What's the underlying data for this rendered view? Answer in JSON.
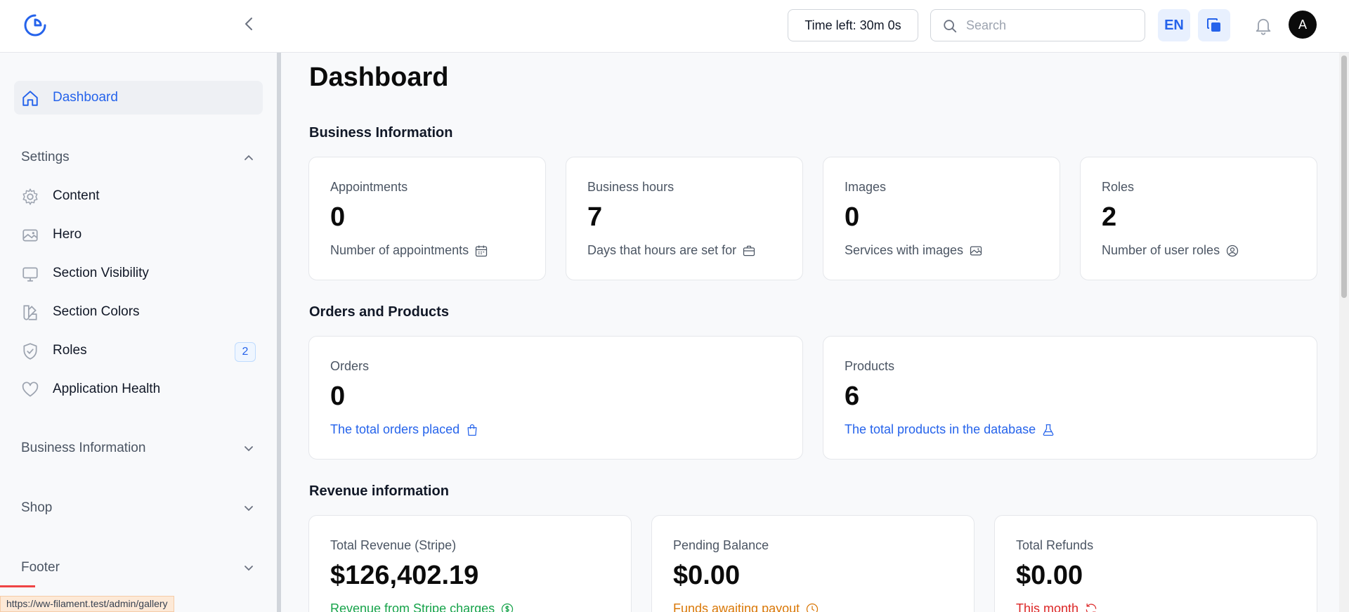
{
  "topbar": {
    "timer": "Time left: 30m 0s",
    "search_placeholder": "Search",
    "language": "EN",
    "avatar_initial": "A"
  },
  "sidebar": {
    "dashboard": "Dashboard",
    "groups": {
      "settings": "Settings",
      "business": "Business Information",
      "shop": "Shop",
      "footer": "Footer"
    },
    "settings_items": [
      {
        "label": "Content",
        "icon": "gear-icon"
      },
      {
        "label": "Hero",
        "icon": "image-icon"
      },
      {
        "label": "Section Visibility",
        "icon": "monitor-icon"
      },
      {
        "label": "Section Colors",
        "icon": "swatch-icon"
      },
      {
        "label": "Roles",
        "icon": "shield-check-icon",
        "badge": "2"
      },
      {
        "label": "Application Health",
        "icon": "heart-icon"
      }
    ]
  },
  "main": {
    "title": "Dashboard",
    "sections": {
      "business": "Business Information",
      "orders": "Orders and Products",
      "revenue": "Revenue information"
    },
    "business_cards": [
      {
        "label": "Appointments",
        "value": "0",
        "desc": "Number of appointments",
        "icon": "calendar-icon"
      },
      {
        "label": "Business hours",
        "value": "7",
        "desc": "Days that hours are set for",
        "icon": "briefcase-icon"
      },
      {
        "label": "Images",
        "value": "0",
        "desc": "Services with images",
        "icon": "photo-icon"
      },
      {
        "label": "Roles",
        "value": "2",
        "desc": "Number of user roles",
        "icon": "user-circle-icon"
      }
    ],
    "order_cards": [
      {
        "label": "Orders",
        "value": "0",
        "desc": "The total orders placed",
        "icon": "shopping-bag-icon"
      },
      {
        "label": "Products",
        "value": "6",
        "desc": "The total products in the database",
        "icon": "beaker-icon"
      }
    ],
    "revenue_cards": [
      {
        "label": "Total Revenue (Stripe)",
        "value": "$126,402.19",
        "desc": "Revenue from Stripe charges",
        "icon": "currency-dollar-icon"
      },
      {
        "label": "Pending Balance",
        "value": "$0.00",
        "desc": "Funds awaiting payout",
        "icon": "clock-icon"
      },
      {
        "label": "Total Refunds",
        "value": "$0.00",
        "desc": "This month",
        "icon": "refresh-icon"
      }
    ]
  },
  "status_bar": {
    "url": "https://ww-filament.test/admin/gallery"
  },
  "colors": {
    "accent": "#2563eb",
    "success": "#16a34a",
    "warning": "#d97706",
    "danger": "#dc2626"
  }
}
